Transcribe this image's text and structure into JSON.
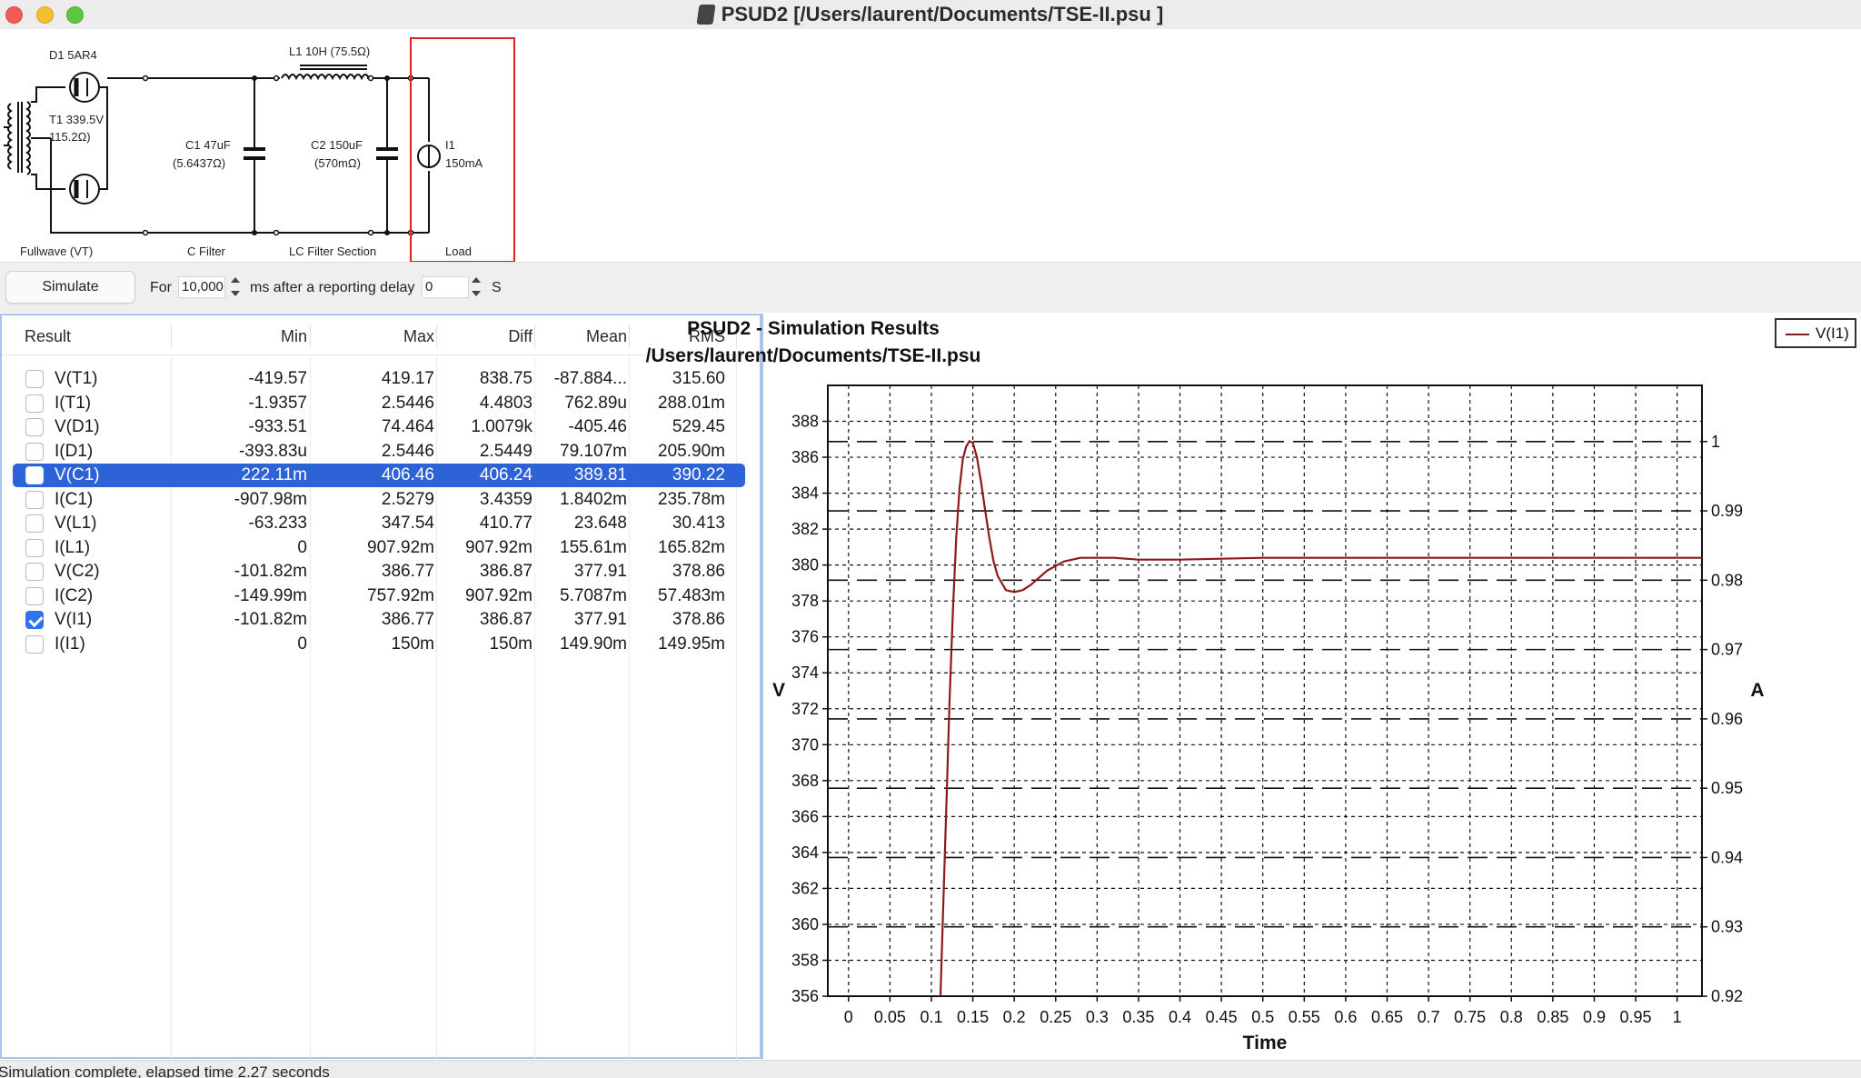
{
  "window": {
    "title": "PSUD2  [/Users/laurent/Documents/TSE-II.psu ]"
  },
  "schematic": {
    "components": {
      "diode": "D1 5AR4",
      "transformer_name": "T1 339.5V",
      "transformer_res": "115.2Ω)",
      "inductor": "L1 10H (75.5Ω)",
      "c1_name": "C1 47uF",
      "c1_esr": "(5.6437Ω)",
      "c2_name": "C2 150uF",
      "c2_esr": "(570mΩ)",
      "load_name": "I1",
      "load_value": "150mA"
    },
    "sections": [
      "Fullwave (VT)",
      "C Filter",
      "LC Filter Section",
      "Load"
    ]
  },
  "toolbar": {
    "simulate_label": "Simulate",
    "for_label": "For",
    "duration_value": "10,000",
    "ms_label": "ms after a reporting delay",
    "delay_value": "0",
    "s_label": "S"
  },
  "results": {
    "headers": [
      "Result",
      "Min",
      "Max",
      "Diff",
      "Mean",
      "RMS"
    ],
    "rows": [
      {
        "name": "V(T1)",
        "min": "-419.57",
        "max": "419.17",
        "diff": "838.75",
        "mean": "-87.884...",
        "rms": "315.60",
        "checked": false,
        "selected": false
      },
      {
        "name": "I(T1)",
        "min": "-1.9357",
        "max": "2.5446",
        "diff": "4.4803",
        "mean": "762.89u",
        "rms": "288.01m",
        "checked": false,
        "selected": false
      },
      {
        "name": "V(D1)",
        "min": "-933.51",
        "max": "74.464",
        "diff": "1.0079k",
        "mean": "-405.46",
        "rms": "529.45",
        "checked": false,
        "selected": false
      },
      {
        "name": "I(D1)",
        "min": "-393.83u",
        "max": "2.5446",
        "diff": "2.5449",
        "mean": "79.107m",
        "rms": "205.90m",
        "checked": false,
        "selected": false
      },
      {
        "name": "V(C1)",
        "min": "222.11m",
        "max": "406.46",
        "diff": "406.24",
        "mean": "389.81",
        "rms": "390.22",
        "checked": false,
        "selected": true
      },
      {
        "name": "I(C1)",
        "min": "-907.98m",
        "max": "2.5279",
        "diff": "3.4359",
        "mean": "1.8402m",
        "rms": "235.78m",
        "checked": false,
        "selected": false
      },
      {
        "name": "V(L1)",
        "min": "-63.233",
        "max": "347.54",
        "diff": "410.77",
        "mean": "23.648",
        "rms": "30.413",
        "checked": false,
        "selected": false
      },
      {
        "name": "I(L1)",
        "min": "0",
        "max": "907.92m",
        "diff": "907.92m",
        "mean": "155.61m",
        "rms": "165.82m",
        "checked": false,
        "selected": false
      },
      {
        "name": "V(C2)",
        "min": "-101.82m",
        "max": "386.77",
        "diff": "386.87",
        "mean": "377.91",
        "rms": "378.86",
        "checked": false,
        "selected": false
      },
      {
        "name": "I(C2)",
        "min": "-149.99m",
        "max": "757.92m",
        "diff": "907.92m",
        "mean": "5.7087m",
        "rms": "57.483m",
        "checked": false,
        "selected": false
      },
      {
        "name": "V(I1)",
        "min": "-101.82m",
        "max": "386.77",
        "diff": "386.87",
        "mean": "377.91",
        "rms": "378.86",
        "checked": true,
        "selected": false
      },
      {
        "name": "I(I1)",
        "min": "0",
        "max": "150m",
        "diff": "150m",
        "mean": "149.90m",
        "rms": "149.95m",
        "checked": false,
        "selected": false
      }
    ]
  },
  "chart_data": {
    "type": "line",
    "title": "PSUD2 - Simulation Results",
    "subtitle": "/Users/laurent/Documents/TSE-II.psu",
    "xlabel": "Time",
    "ylabel_left": "V",
    "ylabel_right": "A",
    "xlim": [
      -0.025,
      1.03
    ],
    "ylim_left": [
      356,
      390
    ],
    "ylim_right": [
      0.92,
      1.0081
    ],
    "x_ticks": [
      "0",
      "0.05",
      "0.1",
      "0.15",
      "0.2",
      "0.25",
      "0.3",
      "0.35",
      "0.4",
      "0.45",
      "0.5",
      "0.55",
      "0.6",
      "0.65",
      "0.7",
      "0.75",
      "0.8",
      "0.85",
      "0.9",
      "0.95",
      "1"
    ],
    "y_left_ticks": [
      356,
      358,
      360,
      362,
      364,
      366,
      368,
      370,
      372,
      374,
      376,
      378,
      380,
      382,
      384,
      386,
      388
    ],
    "y_right_ticks": [
      "0.92",
      "0.93",
      "0.94",
      "0.95",
      "0.96",
      "0.97",
      "0.98",
      "0.99",
      "1"
    ],
    "grid": true,
    "legend_position": "top-right",
    "series": [
      {
        "name": "V(I1)",
        "color": "#8b1a1a",
        "x": [
          0.111,
          0.114,
          0.118,
          0.122,
          0.126,
          0.13,
          0.134,
          0.138,
          0.142,
          0.146,
          0.15,
          0.155,
          0.16,
          0.165,
          0.17,
          0.175,
          0.18,
          0.19,
          0.2,
          0.21,
          0.22,
          0.23,
          0.24,
          0.26,
          0.28,
          0.3,
          0.32,
          0.35,
          0.4,
          0.5,
          0.6,
          0.7,
          0.8,
          0.9,
          1.0,
          1.03
        ],
        "y": [
          356.0,
          360.5,
          366.5,
          372.5,
          377.5,
          381.5,
          384.3,
          385.9,
          386.6,
          386.9,
          386.8,
          386.0,
          384.6,
          383.0,
          381.5,
          380.2,
          379.4,
          378.6,
          378.5,
          378.6,
          378.9,
          379.3,
          379.7,
          380.2,
          380.4,
          380.4,
          380.4,
          380.3,
          380.3,
          380.4,
          380.4,
          380.4,
          380.4,
          380.4,
          380.4,
          380.4
        ]
      }
    ]
  },
  "status": {
    "text": "Simulation complete, elapsed time 2.27 seconds"
  }
}
